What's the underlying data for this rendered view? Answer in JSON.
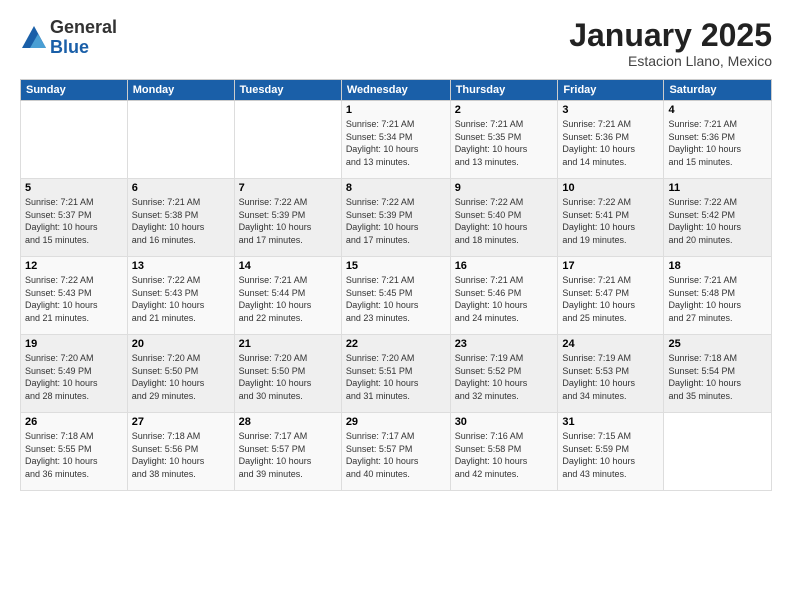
{
  "header": {
    "logo_general": "General",
    "logo_blue": "Blue",
    "month_title": "January 2025",
    "location": "Estacion Llano, Mexico"
  },
  "days_of_week": [
    "Sunday",
    "Monday",
    "Tuesday",
    "Wednesday",
    "Thursday",
    "Friday",
    "Saturday"
  ],
  "weeks": [
    [
      {
        "day": "",
        "info": ""
      },
      {
        "day": "",
        "info": ""
      },
      {
        "day": "",
        "info": ""
      },
      {
        "day": "1",
        "info": "Sunrise: 7:21 AM\nSunset: 5:34 PM\nDaylight: 10 hours\nand 13 minutes."
      },
      {
        "day": "2",
        "info": "Sunrise: 7:21 AM\nSunset: 5:35 PM\nDaylight: 10 hours\nand 13 minutes."
      },
      {
        "day": "3",
        "info": "Sunrise: 7:21 AM\nSunset: 5:36 PM\nDaylight: 10 hours\nand 14 minutes."
      },
      {
        "day": "4",
        "info": "Sunrise: 7:21 AM\nSunset: 5:36 PM\nDaylight: 10 hours\nand 15 minutes."
      }
    ],
    [
      {
        "day": "5",
        "info": "Sunrise: 7:21 AM\nSunset: 5:37 PM\nDaylight: 10 hours\nand 15 minutes."
      },
      {
        "day": "6",
        "info": "Sunrise: 7:21 AM\nSunset: 5:38 PM\nDaylight: 10 hours\nand 16 minutes."
      },
      {
        "day": "7",
        "info": "Sunrise: 7:22 AM\nSunset: 5:39 PM\nDaylight: 10 hours\nand 17 minutes."
      },
      {
        "day": "8",
        "info": "Sunrise: 7:22 AM\nSunset: 5:39 PM\nDaylight: 10 hours\nand 17 minutes."
      },
      {
        "day": "9",
        "info": "Sunrise: 7:22 AM\nSunset: 5:40 PM\nDaylight: 10 hours\nand 18 minutes."
      },
      {
        "day": "10",
        "info": "Sunrise: 7:22 AM\nSunset: 5:41 PM\nDaylight: 10 hours\nand 19 minutes."
      },
      {
        "day": "11",
        "info": "Sunrise: 7:22 AM\nSunset: 5:42 PM\nDaylight: 10 hours\nand 20 minutes."
      }
    ],
    [
      {
        "day": "12",
        "info": "Sunrise: 7:22 AM\nSunset: 5:43 PM\nDaylight: 10 hours\nand 21 minutes."
      },
      {
        "day": "13",
        "info": "Sunrise: 7:22 AM\nSunset: 5:43 PM\nDaylight: 10 hours\nand 21 minutes."
      },
      {
        "day": "14",
        "info": "Sunrise: 7:21 AM\nSunset: 5:44 PM\nDaylight: 10 hours\nand 22 minutes."
      },
      {
        "day": "15",
        "info": "Sunrise: 7:21 AM\nSunset: 5:45 PM\nDaylight: 10 hours\nand 23 minutes."
      },
      {
        "day": "16",
        "info": "Sunrise: 7:21 AM\nSunset: 5:46 PM\nDaylight: 10 hours\nand 24 minutes."
      },
      {
        "day": "17",
        "info": "Sunrise: 7:21 AM\nSunset: 5:47 PM\nDaylight: 10 hours\nand 25 minutes."
      },
      {
        "day": "18",
        "info": "Sunrise: 7:21 AM\nSunset: 5:48 PM\nDaylight: 10 hours\nand 27 minutes."
      }
    ],
    [
      {
        "day": "19",
        "info": "Sunrise: 7:20 AM\nSunset: 5:49 PM\nDaylight: 10 hours\nand 28 minutes."
      },
      {
        "day": "20",
        "info": "Sunrise: 7:20 AM\nSunset: 5:50 PM\nDaylight: 10 hours\nand 29 minutes."
      },
      {
        "day": "21",
        "info": "Sunrise: 7:20 AM\nSunset: 5:50 PM\nDaylight: 10 hours\nand 30 minutes."
      },
      {
        "day": "22",
        "info": "Sunrise: 7:20 AM\nSunset: 5:51 PM\nDaylight: 10 hours\nand 31 minutes."
      },
      {
        "day": "23",
        "info": "Sunrise: 7:19 AM\nSunset: 5:52 PM\nDaylight: 10 hours\nand 32 minutes."
      },
      {
        "day": "24",
        "info": "Sunrise: 7:19 AM\nSunset: 5:53 PM\nDaylight: 10 hours\nand 34 minutes."
      },
      {
        "day": "25",
        "info": "Sunrise: 7:18 AM\nSunset: 5:54 PM\nDaylight: 10 hours\nand 35 minutes."
      }
    ],
    [
      {
        "day": "26",
        "info": "Sunrise: 7:18 AM\nSunset: 5:55 PM\nDaylight: 10 hours\nand 36 minutes."
      },
      {
        "day": "27",
        "info": "Sunrise: 7:18 AM\nSunset: 5:56 PM\nDaylight: 10 hours\nand 38 minutes."
      },
      {
        "day": "28",
        "info": "Sunrise: 7:17 AM\nSunset: 5:57 PM\nDaylight: 10 hours\nand 39 minutes."
      },
      {
        "day": "29",
        "info": "Sunrise: 7:17 AM\nSunset: 5:57 PM\nDaylight: 10 hours\nand 40 minutes."
      },
      {
        "day": "30",
        "info": "Sunrise: 7:16 AM\nSunset: 5:58 PM\nDaylight: 10 hours\nand 42 minutes."
      },
      {
        "day": "31",
        "info": "Sunrise: 7:15 AM\nSunset: 5:59 PM\nDaylight: 10 hours\nand 43 minutes."
      },
      {
        "day": "",
        "info": ""
      }
    ]
  ]
}
